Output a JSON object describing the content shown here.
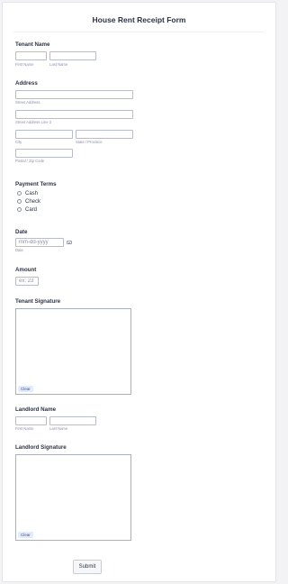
{
  "form": {
    "title": "House Rent Receipt Form"
  },
  "tenant_name": {
    "label": "Tenant Name",
    "first_sublabel": "First Name",
    "last_sublabel": "Last Name",
    "first_value": "",
    "last_value": ""
  },
  "address": {
    "label": "Address",
    "street_sublabel": "Street Address",
    "street2_sublabel": "Street Address Line 2",
    "city_sublabel": "City",
    "state_sublabel": "State / Province",
    "zip_sublabel": "Postal / Zip Code"
  },
  "payment_terms": {
    "label": "Payment Terms",
    "options": [
      "Cash",
      "Check",
      "Card"
    ],
    "selected": null
  },
  "date": {
    "label": "Date",
    "placeholder": "mm-dd-yyyy",
    "sublabel": "Date",
    "icon": "calendar-icon"
  },
  "amount": {
    "label": "Amount",
    "placeholder": "ex: 23"
  },
  "tenant_signature": {
    "label": "Tenant Signature",
    "clear_label": "Clear"
  },
  "landlord_name": {
    "label": "Landlord Name",
    "first_sublabel": "First Name",
    "last_sublabel": "Last Name"
  },
  "landlord_signature": {
    "label": "Landlord Signature",
    "clear_label": "Clear"
  },
  "submit": {
    "label": "Submit"
  },
  "colors": {
    "background": "#f3f3f5",
    "card": "#ffffff",
    "text": "#2c3345",
    "sublabel": "#8d8fa8",
    "clear_button": "#e2ecfa"
  }
}
